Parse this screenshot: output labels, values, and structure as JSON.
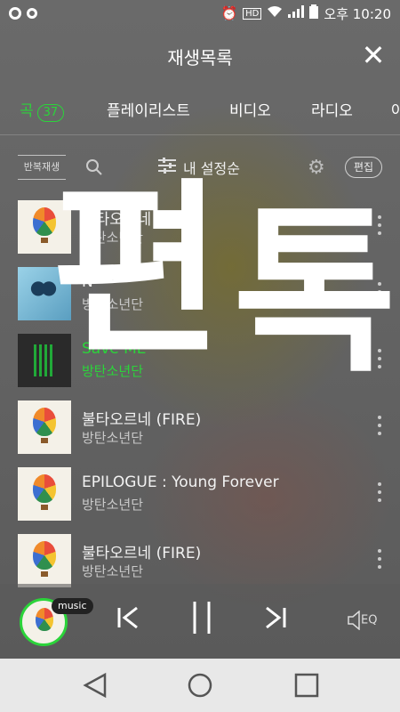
{
  "statusbar": {
    "left_icons": [
      "app-ring-icon",
      "app-ring-icon"
    ],
    "right_icons": [
      "alarm-icon",
      "hd-icon",
      "wifi-icon",
      "signal-icon",
      "battery-icon"
    ],
    "hd": "HD",
    "time": "오후 10:20"
  },
  "header": {
    "title": "재생목록",
    "close": "✕"
  },
  "tabs": [
    {
      "label": "곡",
      "count": "37",
      "active": true
    },
    {
      "label": "플레이리스트"
    },
    {
      "label": "비디오"
    },
    {
      "label": "라디오"
    },
    {
      "label": "아"
    }
  ],
  "toolbar": {
    "repeat_label": "반복재생",
    "sort_label": "내 설정순",
    "edit_label": "편집"
  },
  "songs": [
    {
      "title": "불타오르네 (FIRE)",
      "artist": "방탄소년단",
      "art": "balloon"
    },
    {
      "title": "N",
      "artist": "방탄소년단",
      "art": "butterfly"
    },
    {
      "title": "Save ME",
      "artist": "방탄소년단",
      "art": "neon",
      "playing": true
    },
    {
      "title": "불타오르네 (FIRE)",
      "artist": "방탄소년단",
      "art": "balloon"
    },
    {
      "title": "EPILOGUE : Young Forever",
      "artist": "방탄소년단",
      "art": "balloon"
    },
    {
      "title": "불타오르네 (FIRE)",
      "artist": "방탄소년단",
      "art": "balloon"
    }
  ],
  "player": {
    "badge": "music",
    "eq": "EQ"
  },
  "overlay": {
    "text_1": "편",
    "text_2": "톡"
  },
  "colors": {
    "accent": "#2bd43a",
    "navbar": "#e8e8e8"
  }
}
